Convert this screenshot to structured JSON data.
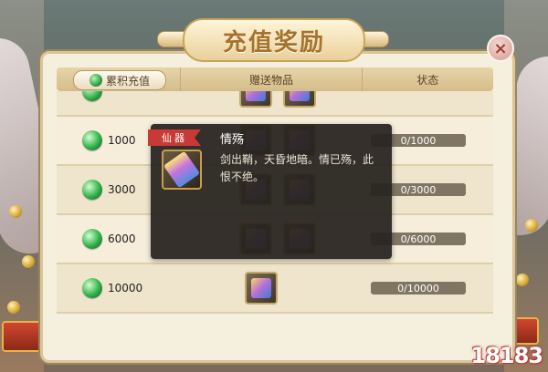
{
  "window": {
    "title": "充值奖励",
    "close_label": "×"
  },
  "header": {
    "col_amount": "累积充值",
    "col_gifts": "赠送物品",
    "col_status": "状态"
  },
  "rows": [
    {
      "amount": "",
      "status": "",
      "gift_icons": [
        "item-icon",
        "item-icon"
      ]
    },
    {
      "amount": "1000",
      "status": "0/1000",
      "gift_icons": [
        "item-icon",
        "item-icon"
      ]
    },
    {
      "amount": "3000",
      "status": "0/3000",
      "gift_icons": [
        "item-icon",
        "item-icon"
      ]
    },
    {
      "amount": "6000",
      "status": "0/6000",
      "gift_icons": [
        "item-icon",
        "item-icon"
      ]
    },
    {
      "amount": "10000",
      "status": "0/10000",
      "gift_icons": [
        "sword-icon"
      ]
    }
  ],
  "tooltip": {
    "tag": "仙器",
    "name": "情殇",
    "description": "剑出鞘，天昏地暗。情已殇，此恨不绝。",
    "icon": "sword-icon"
  },
  "watermark": "18183",
  "colors": {
    "accent_gold": "#a6732b",
    "tag_red": "#c73a35",
    "gem_green": "#31b04a",
    "progress_bg": "#7f7562"
  }
}
